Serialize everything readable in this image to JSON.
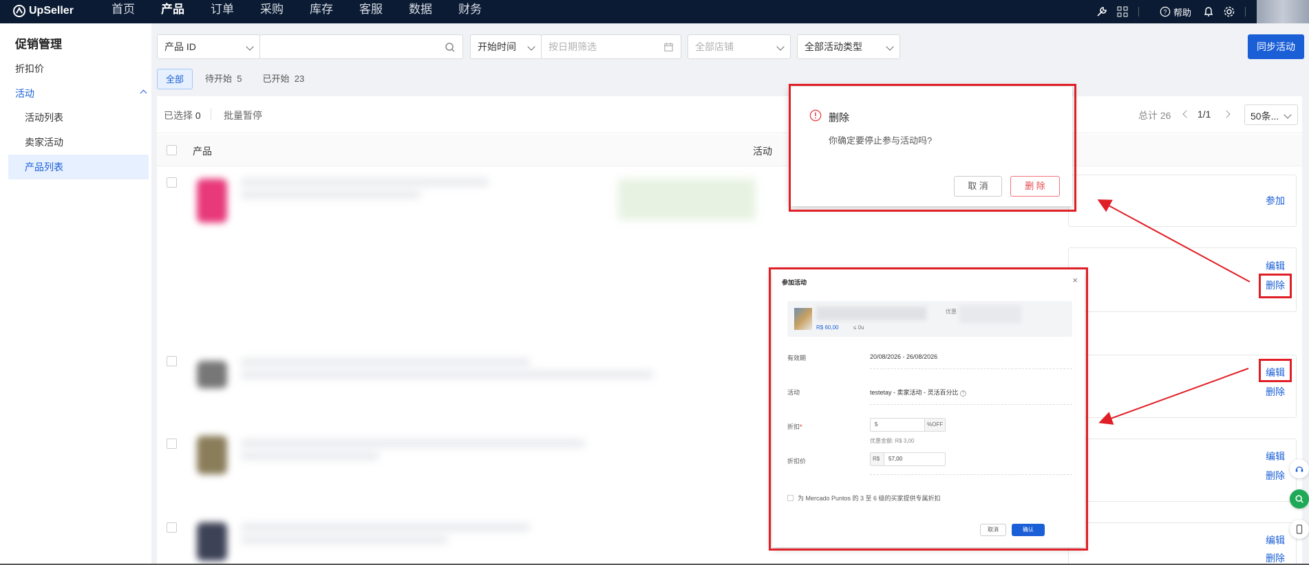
{
  "topbar": {
    "brand": "UpSeller",
    "nav": [
      "首页",
      "产品",
      "订单",
      "采购",
      "库存",
      "客服",
      "数据",
      "财务"
    ],
    "active_nav": "产品",
    "help_label": "帮助"
  },
  "sidebar": {
    "title": "促销管理",
    "discount": "折扣价",
    "activity": "活动",
    "sub": [
      "活动列表",
      "卖家活动",
      "产品列表"
    ],
    "active_sub": "产品列表"
  },
  "filters": {
    "product_id": "产品 ID",
    "start_time": "开始时间",
    "date_placeholder": "按日期筛选",
    "shop_placeholder": "全部店铺",
    "activity_type": "全部活动类型",
    "sync_button": "同步活动"
  },
  "tabs": [
    {
      "label": "全部",
      "count": ""
    },
    {
      "label": "待开始",
      "count": "5"
    },
    {
      "label": "已开始",
      "count": "23"
    }
  ],
  "toolbar": {
    "selected_label": "已选择",
    "selected_count": "0",
    "batch_pause": "批量暂停",
    "total_label": "总计 26",
    "page": "1/1",
    "page_size": "50条..."
  },
  "table": {
    "col_product": "产品",
    "col_activity": "活动"
  },
  "row_actions": {
    "join": "参加",
    "edit": "编辑",
    "delete": "删除"
  },
  "delete_dialog": {
    "title": "删除",
    "message": "你确定要停止参与活动吗?",
    "cancel": "取 消",
    "confirm": "删 除"
  },
  "join_dialog": {
    "title": "参加活动",
    "price": "R$ 60,00",
    "stock": "≤ 0u",
    "discount_tag": "优惠",
    "validity_label": "有效期",
    "validity_value": "20/08/2026 - 26/08/2026",
    "activity_label": "活动",
    "activity_value": "testetay - 卖家活动 - 灵活百分比",
    "discount_label": "折扣",
    "discount_value": "5",
    "discount_unit": "%OFF",
    "discount_amount": "优惠金额: R$ 3,00",
    "price_label": "折扣价",
    "currency": "R$",
    "price_value": "57,00",
    "checkbox_label": "为 Mercado Puntos 的 3 至 6 级的买家提供专属折扣",
    "cancel": "取消",
    "confirm": "确认"
  },
  "colors": {
    "accent": "#1b5fd6",
    "annotation": "#e01e25",
    "topbar": "#0b1b33"
  }
}
